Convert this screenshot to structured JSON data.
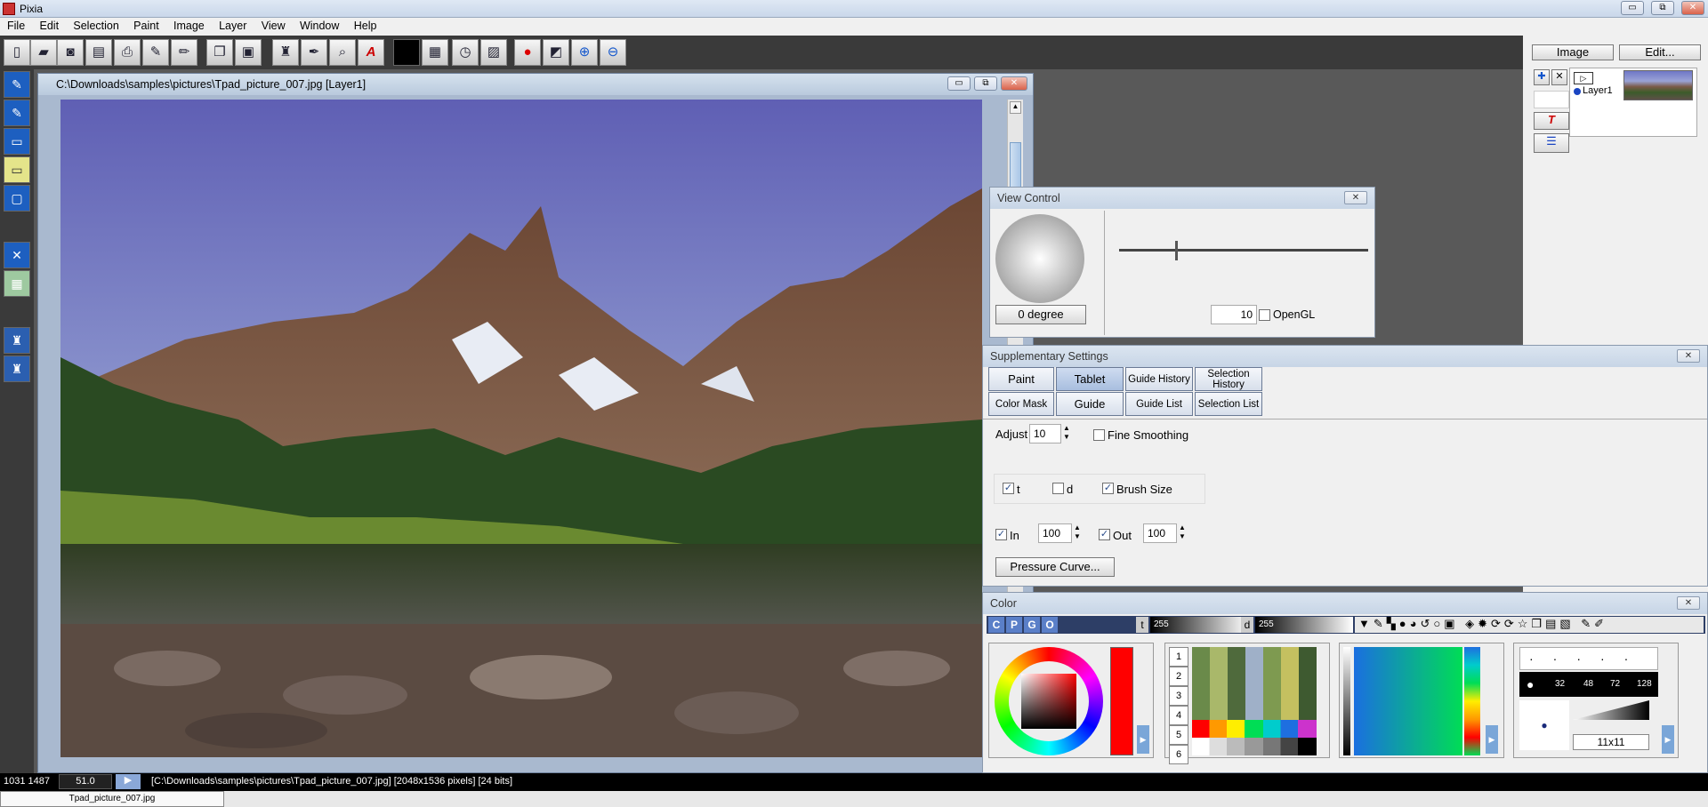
{
  "app": {
    "title": "Pixia"
  },
  "window_controls": {
    "minimize": "▭",
    "restore": "⧉",
    "close": "✕"
  },
  "menu": [
    "File",
    "Edit",
    "Selection",
    "Paint",
    "Image",
    "Layer",
    "View",
    "Window",
    "Help"
  ],
  "toolbar": {
    "icons": [
      "new-file-icon",
      "open-folder-icon",
      "camera-icon",
      "save-icon",
      "print-icon",
      "brush-icon",
      "copy-icon",
      "paste-icon",
      "stamp-icon",
      "dropper-icon",
      "magnifier-icon",
      "text-icon",
      "color-swatch-icon",
      "navigator-icon",
      "clock-icon",
      "notes-icon",
      "record-icon",
      "ruler-icon",
      "zoom-in-icon",
      "zoom-out-icon"
    ]
  },
  "right_panel": {
    "image_button": "Image",
    "edit_button": "Edit...",
    "layer_name": "Layer1"
  },
  "document": {
    "title": "C:\\Downloads\\samples\\pictures\\Tpad_picture_007.jpg [Layer1]"
  },
  "view_control": {
    "title": "View Control",
    "degree_button": "0 degree",
    "zoom_value": "10",
    "opengl_label": "OpenGL",
    "opengl_checked": false
  },
  "supplementary": {
    "title": "Supplementary Settings",
    "tabs": [
      {
        "label": "Paint"
      },
      {
        "label": "Tablet"
      },
      {
        "label": "Guide History"
      },
      {
        "label": "Selection History"
      },
      {
        "label": "Color Mask"
      },
      {
        "label": "Guide"
      },
      {
        "label": "Guide List"
      },
      {
        "label": "Selection List"
      }
    ],
    "active_tab": "Tablet",
    "adjust_label": "Adjust",
    "adjust_value": "10",
    "fine_smoothing_label": "Fine Smoothing",
    "fine_smoothing_checked": false,
    "t_label": "t",
    "d_label": "d",
    "brush_size_label": "Brush Size",
    "in_label": "In",
    "in_value": "100",
    "out_label": "Out",
    "out_value": "100",
    "pressure_button": "Pressure Curve..."
  },
  "color_panel": {
    "title": "Color",
    "mode_buttons": [
      "C",
      "P",
      "G",
      "O"
    ],
    "t_label": "t",
    "t_value": "255",
    "d_label": "d",
    "d_value": "255",
    "palette_rows": [
      "1",
      "2",
      "3",
      "4",
      "5",
      "6"
    ],
    "brush_sizes": [
      "32",
      "48",
      "72",
      "128"
    ],
    "brush_dims": "11x11",
    "current_color": "#ff0000"
  },
  "status": {
    "coords": "1031 1487",
    "zoom": "51.0",
    "info": "[C:\\Downloads\\samples\\pictures\\Tpad_picture_007.jpg] [2048x1536 pixels] [24 bits]"
  },
  "taskbar": {
    "item": "Tpad_picture_007.jpg"
  }
}
